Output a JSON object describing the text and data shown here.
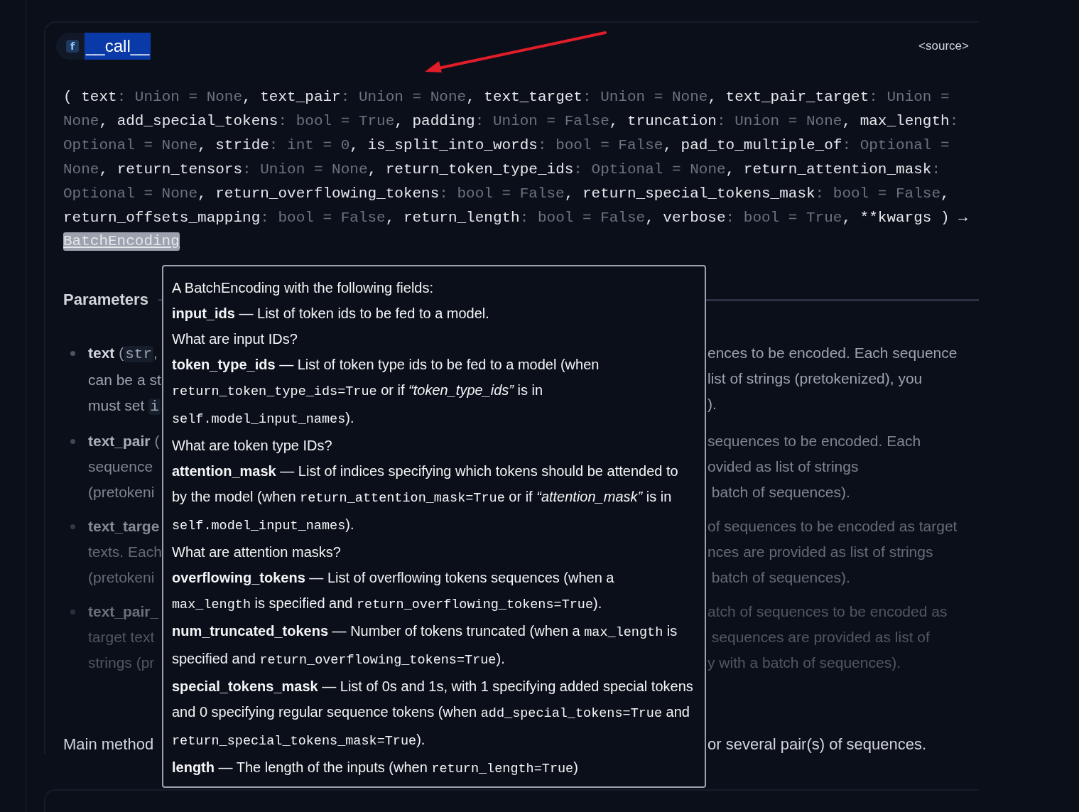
{
  "header": {
    "function_icon": "f",
    "name": "__call__",
    "source_link": "<source>"
  },
  "signature": {
    "lines": [
      [
        {
          "kind": "name",
          "text": "( text"
        },
        {
          "kind": "type",
          "text": ": Union = None"
        },
        {
          "kind": "name",
          "text": ", text_pair"
        },
        {
          "kind": "type",
          "text": ": Union = None"
        },
        {
          "kind": "name",
          "text": ", text_target"
        },
        {
          "kind": "type",
          "text": ": Union = None"
        },
        {
          "kind": "name",
          "text": ", text_pair_target"
        },
        {
          "kind": "type",
          "text": ": Union ="
        }
      ],
      [
        {
          "kind": "type",
          "text": "None"
        },
        {
          "kind": "name",
          "text": ", add_special_tokens"
        },
        {
          "kind": "type",
          "text": ": bool = True"
        },
        {
          "kind": "name",
          "text": ", padding"
        },
        {
          "kind": "type",
          "text": ": Union = False"
        },
        {
          "kind": "name",
          "text": ", truncation"
        },
        {
          "kind": "type",
          "text": ": Union = None"
        },
        {
          "kind": "name",
          "text": ", max_length"
        },
        {
          "kind": "type",
          "text": ":"
        }
      ],
      [
        {
          "kind": "type",
          "text": "Optional = None"
        },
        {
          "kind": "name",
          "text": ", stride"
        },
        {
          "kind": "type",
          "text": ": int = 0"
        },
        {
          "kind": "name",
          "text": ", is_split_into_words"
        },
        {
          "kind": "type",
          "text": ": bool = False"
        },
        {
          "kind": "name",
          "text": ", pad_to_multiple_of"
        },
        {
          "kind": "type",
          "text": ": Optional ="
        }
      ],
      [
        {
          "kind": "type",
          "text": "None"
        },
        {
          "kind": "name",
          "text": ", return_tensors"
        },
        {
          "kind": "type",
          "text": ": Union = None"
        },
        {
          "kind": "name",
          "text": ", return_token_type_ids"
        },
        {
          "kind": "type",
          "text": ": Optional = None"
        },
        {
          "kind": "name",
          "text": ", return_attention_mask"
        },
        {
          "kind": "type",
          "text": ":"
        }
      ],
      [
        {
          "kind": "type",
          "text": "Optional = None"
        },
        {
          "kind": "name",
          "text": ", return_overflowing_tokens"
        },
        {
          "kind": "type",
          "text": ": bool = False"
        },
        {
          "kind": "name",
          "text": ", return_special_tokens_mask"
        },
        {
          "kind": "type",
          "text": ": bool = False"
        },
        {
          "kind": "name",
          "text": ","
        }
      ],
      [
        {
          "kind": "name",
          "text": "return_offsets_mapping"
        },
        {
          "kind": "type",
          "text": ": bool = False"
        },
        {
          "kind": "name",
          "text": ", return_length"
        },
        {
          "kind": "type",
          "text": ": bool = False"
        },
        {
          "kind": "name",
          "text": ", verbose"
        },
        {
          "kind": "type",
          "text": ": bool = True"
        },
        {
          "kind": "name",
          "text": ", **kwargs ) →"
        }
      ]
    ],
    "return_type": "BatchEncoding"
  },
  "parameters": {
    "heading": "Parameters",
    "items": [
      {
        "left": [
          [
            {
              "kind": "bold",
              "text": "text"
            },
            {
              "kind": "text",
              "text": " ("
            },
            {
              "kind": "code",
              "text": "str"
            },
            {
              "kind": "text",
              "text": ","
            }
          ],
          [
            {
              "kind": "text",
              "text": "can be a st"
            }
          ],
          [
            {
              "kind": "text",
              "text": "must set "
            },
            {
              "kind": "code",
              "text": "i"
            }
          ]
        ],
        "right": [
          [
            {
              "kind": "text",
              "text": "ences to be encoded. Each sequence"
            }
          ],
          [
            {
              "kind": "text",
              "text": "list of strings (pretokenized), you"
            }
          ],
          [
            {
              "kind": "text",
              "text": ")."
            }
          ]
        ]
      },
      {
        "left": [
          [
            {
              "kind": "bold",
              "text": "text_pair"
            },
            {
              "kind": "text",
              "text": " ("
            }
          ],
          [
            {
              "kind": "text",
              "text": "sequence"
            }
          ],
          [
            {
              "kind": "text",
              "text": "(pretokeni"
            }
          ]
        ],
        "right": [
          [
            {
              "kind": "text",
              "text": "sequences to be encoded. Each"
            }
          ],
          [
            {
              "kind": "text",
              "text": "ovided as list of strings"
            }
          ],
          [
            {
              "kind": "text",
              "text": " batch of sequences)."
            }
          ]
        ]
      },
      {
        "left": [
          [
            {
              "kind": "bold",
              "text": "text_targe"
            }
          ],
          [
            {
              "kind": "text",
              "text": "texts. Each"
            }
          ],
          [
            {
              "kind": "text",
              "text": "(pretokeni"
            }
          ]
        ],
        "right": [
          [
            {
              "kind": "text",
              "text": "of sequences to be encoded as target"
            }
          ],
          [
            {
              "kind": "text",
              "text": "nces are provided as list of strings"
            }
          ],
          [
            {
              "kind": "text",
              "text": " batch of sequences)."
            }
          ]
        ]
      },
      {
        "left": [
          [
            {
              "kind": "bold",
              "text": "text_pair_"
            }
          ],
          [
            {
              "kind": "text",
              "text": "target text"
            }
          ],
          [
            {
              "kind": "text",
              "text": "strings (pr"
            }
          ]
        ],
        "right": [
          [
            {
              "kind": "text",
              "text": "atch of sequences to be encoded as"
            }
          ],
          [
            {
              "kind": "text",
              "text": " sequences are provided as list of"
            }
          ],
          [
            {
              "kind": "text",
              "text": "y with a batch of sequences)."
            }
          ]
        ]
      }
    ]
  },
  "description": {
    "left": "Main method",
    "right": "or several pair(s) of sequences."
  },
  "tooltip": {
    "lines": [
      {
        "kind": "intro",
        "text": "A BatchEncoding with the following fields:"
      },
      {
        "kind": "field",
        "segments": [
          {
            "kind": "bold",
            "text": "input_ids"
          },
          {
            "kind": "text",
            "text": " — List of token ids to be fed to a model."
          }
        ]
      },
      {
        "kind": "link",
        "text": "What are input IDs?"
      },
      {
        "kind": "field",
        "segments": [
          {
            "kind": "bold",
            "text": "token_type_ids"
          },
          {
            "kind": "text",
            "text": " — List of token type ids to be fed to a model (when "
          },
          {
            "kind": "code",
            "text": "return_token_type_ids=True"
          },
          {
            "kind": "text",
            "text": " or if "
          },
          {
            "kind": "italic",
            "text": "“token_type_ids”"
          },
          {
            "kind": "text",
            "text": " is in "
          },
          {
            "kind": "code",
            "text": "self.model_input_names"
          },
          {
            "kind": "text",
            "text": ")."
          }
        ]
      },
      {
        "kind": "link",
        "text": "What are token type IDs?"
      },
      {
        "kind": "field",
        "segments": [
          {
            "kind": "bold",
            "text": "attention_mask"
          },
          {
            "kind": "text",
            "text": " — List of indices specifying which tokens should be attended to by the model (when "
          },
          {
            "kind": "code",
            "text": "return_attention_mask=True"
          },
          {
            "kind": "text",
            "text": " or if "
          },
          {
            "kind": "italic",
            "text": "“attention_mask”"
          },
          {
            "kind": "text",
            "text": " is in "
          },
          {
            "kind": "code",
            "text": "self.model_input_names"
          },
          {
            "kind": "text",
            "text": ")."
          }
        ]
      },
      {
        "kind": "link",
        "text": "What are attention masks?"
      },
      {
        "kind": "field",
        "segments": [
          {
            "kind": "bold",
            "text": "overflowing_tokens"
          },
          {
            "kind": "text",
            "text": " — List of overflowing tokens sequences (when a "
          },
          {
            "kind": "code",
            "text": "max_length"
          },
          {
            "kind": "text",
            "text": " is specified and "
          },
          {
            "kind": "code",
            "text": "return_overflowing_tokens=True"
          },
          {
            "kind": "text",
            "text": ")."
          }
        ]
      },
      {
        "kind": "field",
        "segments": [
          {
            "kind": "bold",
            "text": "num_truncated_tokens"
          },
          {
            "kind": "text",
            "text": " — Number of tokens truncated (when a "
          },
          {
            "kind": "code",
            "text": "max_length"
          },
          {
            "kind": "text",
            "text": " is specified and "
          },
          {
            "kind": "code",
            "text": "return_overflowing_tokens=True"
          },
          {
            "kind": "text",
            "text": ")."
          }
        ]
      },
      {
        "kind": "field",
        "segments": [
          {
            "kind": "bold",
            "text": "special_tokens_mask"
          },
          {
            "kind": "text",
            "text": " — List of 0s and 1s, with 1 specifying added special tokens and 0 specifying regular sequence tokens (when "
          },
          {
            "kind": "code",
            "text": "add_special_tokens=True"
          },
          {
            "kind": "text",
            "text": " and "
          },
          {
            "kind": "code",
            "text": "return_special_tokens_mask=True"
          },
          {
            "kind": "text",
            "text": ")."
          }
        ]
      },
      {
        "kind": "field",
        "segments": [
          {
            "kind": "bold",
            "text": "length"
          },
          {
            "kind": "text",
            "text": " — The length of the inputs (when "
          },
          {
            "kind": "code",
            "text": "return_length=True"
          },
          {
            "kind": "text",
            "text": ")"
          }
        ]
      }
    ]
  }
}
